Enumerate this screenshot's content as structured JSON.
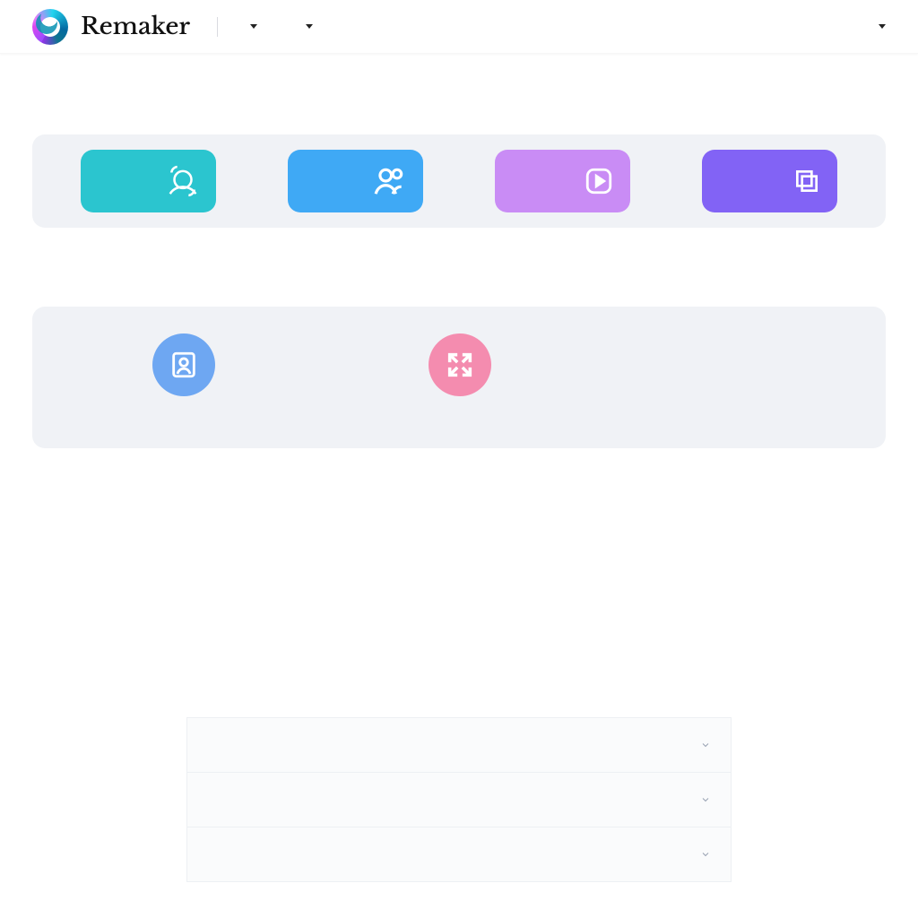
{
  "brand": {
    "name": "Remaker"
  },
  "nav": {
    "items": [
      {
        "label": ""
      },
      {
        "label": ""
      }
    ],
    "right": [
      {
        "label": ""
      }
    ]
  },
  "quick_tools": [
    {
      "label": "",
      "icon": "face-swap",
      "color": "teal"
    },
    {
      "label": "",
      "icon": "multi-face",
      "color": "blue"
    },
    {
      "label": "",
      "icon": "video",
      "color": "pink"
    },
    {
      "label": "",
      "icon": "batch",
      "color": "purple"
    }
  ],
  "all_tools": [
    {
      "label": "",
      "icon": "headshot",
      "color": "bl"
    },
    {
      "label": "",
      "icon": "expand",
      "color": "pk"
    }
  ],
  "faq": {
    "items": [
      {
        "q": ""
      },
      {
        "q": ""
      },
      {
        "q": ""
      }
    ]
  }
}
